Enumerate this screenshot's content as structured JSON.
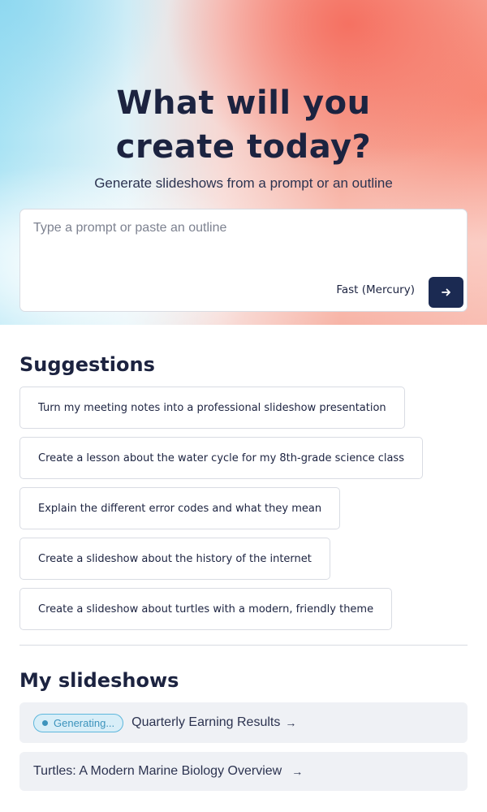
{
  "hero": {
    "title": "What will you create today?",
    "subtitle": "Generate slideshows from a prompt or an outline"
  },
  "prompt": {
    "placeholder": "Type a prompt or paste an outline",
    "value": "",
    "model_label": "Fast (Mercury)",
    "submit_icon": "arrow-right-icon"
  },
  "suggestions": {
    "title": "Suggestions",
    "items": [
      "Turn my meeting notes into a professional slideshow presentation",
      "Create a lesson about the water cycle for my 8th-grade science class",
      "Explain the different error codes and what they mean",
      "Create a slideshow about the history of the internet",
      "Create a slideshow about turtles with a modern, friendly theme"
    ]
  },
  "slideshows": {
    "title": "My slideshows",
    "items": [
      {
        "status": "Generating...",
        "title": "Quarterly Earning Results",
        "arrow": "→"
      },
      {
        "status": "",
        "title": "Turtles: A Modern Marine Biology Overview",
        "arrow": "→"
      }
    ]
  },
  "colors": {
    "text_primary": "#1c2340",
    "submit_button": "#1b2a52",
    "badge_background": "#d8eef8",
    "badge_text": "#3c93bc",
    "row_background": "#eff1f5",
    "gradient_coral": "#f56e5f",
    "gradient_cyan": "#a9e3f4"
  }
}
